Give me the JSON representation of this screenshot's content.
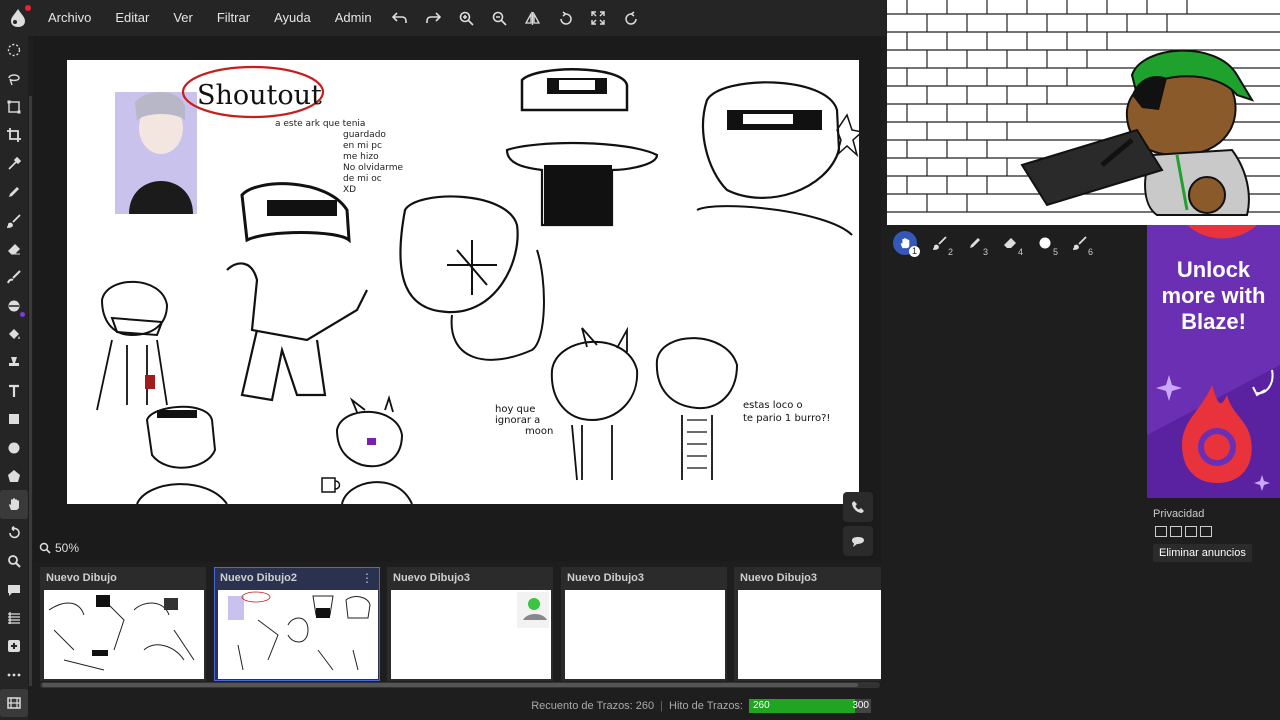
{
  "menubar": {
    "items": [
      "Archivo",
      "Editar",
      "Ver",
      "Filtrar",
      "Ayuda",
      "Admin"
    ],
    "tools": [
      "undo-icon",
      "redo-icon",
      "zoom-in-icon",
      "zoom-out-icon",
      "flip-icon",
      "rotate-icon",
      "fullscreen-icon",
      "reset-icon"
    ]
  },
  "toolbar": {
    "tools": [
      "lasso-icon",
      "free-lasso-icon",
      "select-rect-icon",
      "crop-icon",
      "eyedropper-icon",
      "pen-icon",
      "brush-icon",
      "eraser-icon",
      "smudge-icon",
      "blend-icon",
      "fill-icon",
      "stamp-icon",
      "text-icon",
      "rect-shape-icon",
      "ellipse-shape-icon",
      "polygon-shape-icon",
      "hand-icon",
      "undo-history-icon",
      "search-icon",
      "chat-icon",
      "layers-icon",
      "add-icon",
      "more-icon",
      "film-icon"
    ],
    "active_index": 16
  },
  "canvas": {
    "texts": {
      "shoutout": "Shoutout",
      "note": "a este ark que tenia guardado en mi pc me hizo No olvidarme de mi oc XD",
      "hoy": "hoy que ignorar a moon",
      "estas": "estas loco o te pario 1 burro?!"
    }
  },
  "zoom": {
    "label": "50%"
  },
  "frames": [
    {
      "title": "Nuevo Dibujo",
      "selected": false
    },
    {
      "title": "Nuevo Dibujo2",
      "selected": true
    },
    {
      "title": "Nuevo Dibujo3",
      "selected": false
    },
    {
      "title": "Nuevo Dibujo3",
      "selected": false
    },
    {
      "title": "Nuevo Dibujo3",
      "selected": false
    }
  ],
  "status": {
    "stroke_count_label": "Recuento de Trazos: 260",
    "stroke_milestone_label": "Hito de Trazos:",
    "meter_current": "260",
    "meter_max": "300",
    "meter_fraction": 0.867
  },
  "brushes": [
    {
      "icon": "hand-icon",
      "num": "1"
    },
    {
      "icon": "brush-icon",
      "num": "2"
    },
    {
      "icon": "pen-icon",
      "num": "3"
    },
    {
      "icon": "eraser-icon",
      "num": "4"
    },
    {
      "icon": "dot-icon",
      "num": "5"
    },
    {
      "icon": "brush-icon",
      "num": "6"
    }
  ],
  "ad": {
    "text": "Unlock more with Blaze!"
  },
  "privacy": {
    "label": "Privacidad",
    "remove_ads": "Eliminar anuncios"
  },
  "colors": {
    "accent": "#3558b8",
    "meter": "#1fa51f",
    "ad_bg": "#6b2fb4",
    "ad_icon": "#e8323c"
  }
}
